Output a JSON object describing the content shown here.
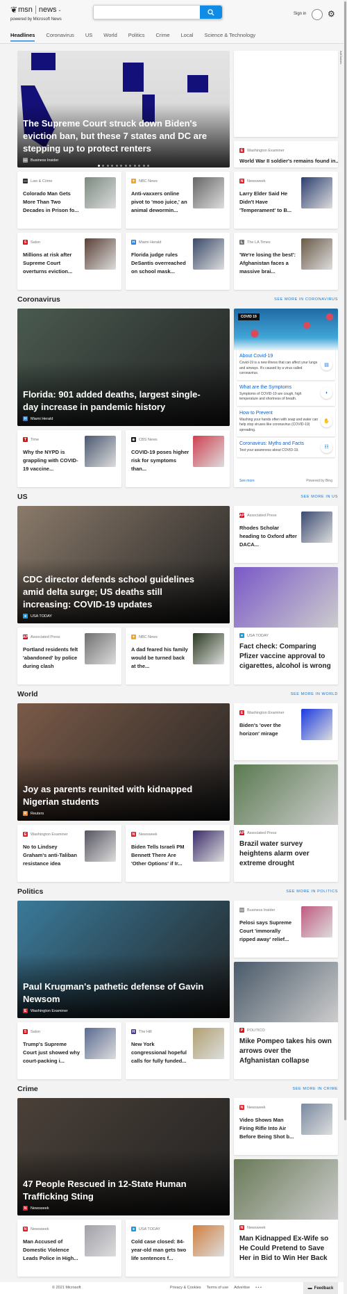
{
  "header": {
    "logo": "msn",
    "product": "news",
    "tagline": "powered by Microsoft News",
    "search_value": "",
    "sign_in": "Sign in"
  },
  "nav": [
    "Headlines",
    "Coronavirus",
    "US",
    "World",
    "Politics",
    "Crime",
    "Local",
    "Science & Technology"
  ],
  "nav_active": "Headlines",
  "colors": {
    "accent": "#0f8de6",
    "link": "#1a73c8"
  },
  "sources": {
    "Business Insider": {
      "icon": "business-insider-icon",
      "color": "#999999",
      "glyph": "—"
    },
    "Washington Examiner": {
      "icon": "washington-examiner-icon",
      "color": "#e0202a",
      "glyph": "E"
    },
    "Law & Crime": {
      "icon": "law-and-crime-icon",
      "color": "#333333",
      "glyph": "—"
    },
    "NBC News": {
      "icon": "nbc-peacock-icon",
      "color": "#f5a623",
      "glyph": "✦"
    },
    "Newsweek": {
      "icon": "newsweek-icon",
      "color": "#e41b23",
      "glyph": "N"
    },
    "Salon": {
      "icon": "salon-icon",
      "color": "#e01010",
      "glyph": "S"
    },
    "Miami Herald": {
      "icon": "miami-herald-icon",
      "color": "#2a7de1",
      "glyph": "H"
    },
    "The LA Times": {
      "icon": "la-times-icon",
      "color": "#777777",
      "glyph": "L"
    },
    "Time": {
      "icon": "time-icon",
      "color": "#e01010",
      "glyph": "T"
    },
    "CBS News": {
      "icon": "cbs-eye-icon",
      "color": "#111111",
      "glyph": "◉"
    },
    "Associated Press": {
      "icon": "ap-icon",
      "color": "#d01020",
      "glyph": "AP"
    },
    "USA TODAY": {
      "icon": "usa-today-icon",
      "color": "#1a9be6",
      "glyph": "●"
    },
    "Reuters": {
      "icon": "reuters-icon",
      "color": "#f08020",
      "glyph": "R"
    },
    "The Hill": {
      "icon": "the-hill-icon",
      "color": "#4a3a8a",
      "glyph": "H"
    },
    "POLITICO": {
      "icon": "politico-icon",
      "color": "#e01010",
      "glyph": "P"
    }
  },
  "headlines": {
    "hero": {
      "title": "The Supreme Court struck down Biden's eviction ban, but these 7 states and DC are stepping up to protect renters",
      "source": "Business Insider",
      "image": "#dcdcdc",
      "dots": 12,
      "active_dot": 1
    },
    "ad_label": "AdChoices",
    "side": {
      "source": "Washington Examiner",
      "title": "World War II soldier's remains found in..."
    },
    "cards": [
      {
        "source": "Law & Crime",
        "title": "Colorado Man Gets More Than Two Decades in Prison fo...",
        "thumb": "#7a8a80"
      },
      {
        "source": "NBC News",
        "title": "Anti-vaxxers online pivot to 'moo juice,' an animal dewormin...",
        "thumb": "#666666"
      },
      {
        "source": "Newsweek",
        "title": "Larry Elder Said He Didn't Have 'Temperament' to B...",
        "thumb": "#2c3e70"
      },
      {
        "source": "Salon",
        "title": "Millions at risk after Supreme Court overturns eviction...",
        "thumb": "#5a4036"
      },
      {
        "source": "Miami Herald",
        "title": "Florida judge rules DeSantis overreached on school mask...",
        "thumb": "#3a4a6a"
      },
      {
        "source": "The LA Times",
        "title": "'We're losing the best': Afghanistan faces a massive brai...",
        "thumb": "#6a5a48"
      }
    ]
  },
  "sections": [
    {
      "id": "coronavirus",
      "title": "Coronavirus",
      "see_more": "SEE MORE IN CORONAVIRUS",
      "hero": {
        "title": "Florida: 901 added deaths, largest single-day increase in pandemic history",
        "source": "Miami Herald",
        "image": "#4a5a50"
      },
      "cards": [
        {
          "source": "Time",
          "title": "Why the NYPD is grappling with COVID-19 vaccine...",
          "thumb": "#4a5870"
        },
        {
          "source": "CBS News",
          "title": "COVID-19 poses higher risk for symptoms than...",
          "thumb": "#d04050"
        }
      ],
      "covid": {
        "badge": "COVID 19",
        "items": [
          {
            "title": "About Covid-19",
            "desc": "Covid-19 is a new illness that can affect your lungs and airways. It's caused by a virus called coronavirus.",
            "icon": "document-icon",
            "glyph": "▤"
          },
          {
            "title": "What are the Symptoms",
            "desc": "Symptoms of COVID-19 are cough, high temperature and shortness of breath.",
            "icon": "symptoms-icon",
            "glyph": "◗"
          },
          {
            "title": "How to Prevent",
            "desc": "Washing your hands often with soap and water can help stop viruses like coronavirus (COVID-19) spreading.",
            "icon": "handwash-icon",
            "glyph": "✋"
          },
          {
            "title": "Coronavirus: Myths and Facts",
            "desc": "Test your awareness about COVID-19.",
            "icon": "quiz-icon",
            "glyph": "☷"
          }
        ],
        "see_more": "See more",
        "powered": "Powered by Bing"
      }
    },
    {
      "id": "us",
      "title": "US",
      "see_more": "SEE MORE IN US",
      "hero": {
        "title": "CDC director defends school guidelines amid delta surge; US deaths still increasing: COVID-19 updates",
        "source": "USA TODAY",
        "image": "#8a7a6a"
      },
      "side": {
        "source": "Associated Press",
        "title": "Rhodes Scholar heading to Oxford after DACA...",
        "thumb": "#3a4a70"
      },
      "big": {
        "source": "USA TODAY",
        "title": "Fact check: Comparing Pfizer vaccine approval to cigarettes, alcohol is wrong",
        "image": "#7a58c8"
      },
      "cards": [
        {
          "source": "Associated Press",
          "title": "Portland residents felt 'abandoned' by police during clash",
          "thumb": "#707070"
        },
        {
          "source": "NBC News",
          "title": "A dad feared his family would be turned back at the...",
          "thumb": "#2a3a20"
        }
      ]
    },
    {
      "id": "world",
      "title": "World",
      "see_more": "SEE MORE IN WORLD",
      "hero": {
        "title": "Joy as parents reunited with kidnapped Nigerian students",
        "source": "Reuters",
        "image": "#7a5a48"
      },
      "side": {
        "source": "Washington Examiner",
        "title": "Biden's 'over the horizon' mirage",
        "thumb": "#1a3ae0"
      },
      "big": {
        "source": "Associated Press",
        "title": "Brazil water survey heightens alarm over extreme drought",
        "image": "#5a7a50"
      },
      "cards": [
        {
          "source": "Washington Examiner",
          "title": "No to Lindsey Graham's anti-Taliban resistance idea",
          "thumb": "#555560"
        },
        {
          "source": "Newsweek",
          "title": "Biden Tells Israeli PM Bennett There Are 'Other Options' if Ir...",
          "thumb": "#3a2a6a"
        }
      ]
    },
    {
      "id": "politics",
      "title": "Politics",
      "see_more": "SEE MORE IN POLITICS",
      "hero": {
        "title": "Paul Krugman's pathetic defense of Gavin Newsom",
        "source": "Washington Examiner",
        "image": "#3a7a9a"
      },
      "side": {
        "source": "Business Insider",
        "title": "Pelosi says Supreme Court 'immorally ripped away' relief...",
        "thumb": "#c05a80"
      },
      "big": {
        "source": "POLITICO",
        "title": "Mike Pompeo takes his own arrows over the Afghanistan collapse",
        "image": "#4a5a6a"
      },
      "cards": [
        {
          "source": "Salon",
          "title": "Trump's Supreme Court just showed why court-packing i...",
          "thumb": "#5a6a90"
        },
        {
          "source": "The Hill",
          "title": "New York congressional hopeful calls for fully funded...",
          "thumb": "#b0a070"
        }
      ]
    },
    {
      "id": "crime",
      "title": "Crime",
      "see_more": "SEE MORE IN CRIME",
      "hero": {
        "title": "47 People Rescued in 12-State Human Trafficking Sting",
        "source": "Newsweek",
        "image": "#4a4038"
      },
      "side": {
        "source": "Newsweek",
        "title": "Video Shows Man Firing Rifle Into Air Before Being Shot b...",
        "thumb": "#7a8aa0"
      },
      "big": {
        "source": "Newsweek",
        "title": "Man Kidnapped Ex-Wife so He Could Pretend to Save Her in Bid to Win Her Back",
        "image": "#6a7a58"
      },
      "cards": [
        {
          "source": "Newsweek",
          "title": "Man Accused of Domestic Violence Leads Police in High...",
          "thumb": "#a0a0a8"
        },
        {
          "source": "USA TODAY",
          "title": "Cold case closed: 84-year-old man gets two life sentences f...",
          "thumb": "#d08040"
        }
      ]
    }
  ],
  "footer": {
    "copyright": "© 2021 Microsoft",
    "links": [
      "Privacy & Cookies",
      "Terms of use",
      "Advertise",
      "• • •"
    ],
    "feedback": "Feedback"
  }
}
